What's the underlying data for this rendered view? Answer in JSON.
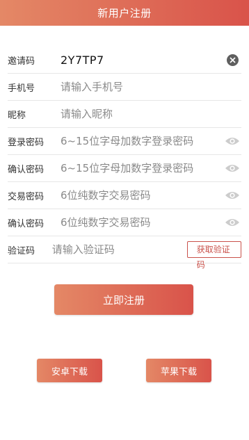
{
  "header": {
    "title": "新用户注册"
  },
  "form": {
    "invite": {
      "label": "邀请码",
      "value": "2Y7TP7",
      "clear_icon": "close-icon"
    },
    "phone": {
      "label": "手机号",
      "placeholder": "请输入手机号"
    },
    "nickname": {
      "label": "昵称",
      "placeholder": "请输入昵称"
    },
    "login_password": {
      "label": "登录密码",
      "placeholder": "6~15位字母加数字登录密码",
      "icon": "eye-icon"
    },
    "confirm_login_password": {
      "label": "确认密码",
      "placeholder": "6~15位字母加数字登录密码",
      "icon": "eye-icon"
    },
    "trade_password": {
      "label": "交易密码",
      "placeholder": "6位纯数字交易密码",
      "icon": "eye-icon"
    },
    "confirm_trade_password": {
      "label": "确认密码",
      "placeholder": "6位纯数字交易密码",
      "icon": "eye-icon"
    },
    "verify_code": {
      "label": "验证码",
      "placeholder": "请输入验证码",
      "button_label": "获取验证码"
    }
  },
  "submit": {
    "label": "立即注册"
  },
  "downloads": {
    "android_label": "安卓下载",
    "ios_label": "苹果下载"
  },
  "colors": {
    "accent_start": "#e48866",
    "accent_end": "#d9534a",
    "button_border": "#c9514a"
  }
}
